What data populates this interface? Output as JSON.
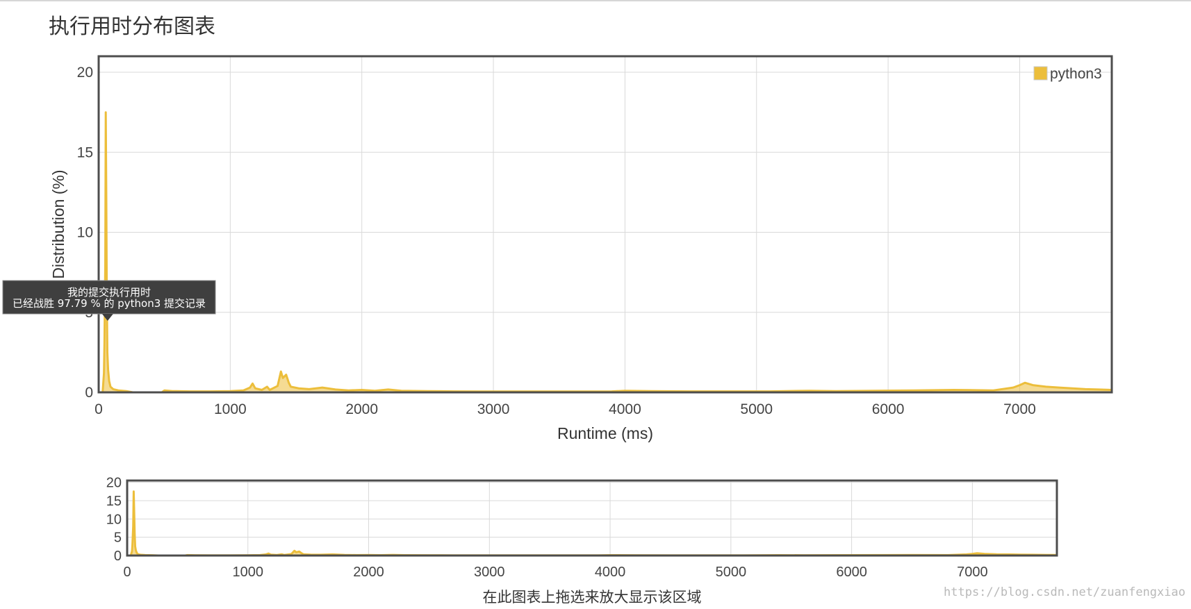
{
  "page": {
    "title": "执行用时分布图表",
    "watermark": "https://blog.csdn.net/zuanfengxiao"
  },
  "colors": {
    "series": "#ecbe3b",
    "grid": "#d9d9d9",
    "frame": "#4d4d4d",
    "tooltip_bg": "#3f3f3f"
  },
  "chart_data": [
    {
      "type": "area",
      "title": "",
      "xlabel": "Runtime (ms)",
      "ylabel": "Distribution (%)",
      "xlim": [
        0,
        7700
      ],
      "ylim": [
        0,
        21
      ],
      "xticks": [
        0,
        1000,
        2000,
        3000,
        4000,
        5000,
        6000,
        7000
      ],
      "yticks": [
        0,
        5,
        10,
        15,
        20
      ],
      "grid": true,
      "legend": {
        "position": "top-right",
        "entries": [
          "python3"
        ]
      },
      "series": [
        {
          "name": "python3",
          "points": [
            [
              0,
              0
            ],
            [
              30,
              0
            ],
            [
              40,
              1.2
            ],
            [
              44,
              3
            ],
            [
              50,
              8
            ],
            [
              54,
              17.5
            ],
            [
              58,
              12
            ],
            [
              62,
              6
            ],
            [
              66,
              2.5
            ],
            [
              72,
              1.4
            ],
            [
              80,
              0.7
            ],
            [
              90,
              0.35
            ],
            [
              110,
              0.2
            ],
            [
              150,
              0.12
            ],
            [
              210,
              0.08
            ],
            [
              260,
              0
            ],
            [
              480,
              0
            ],
            [
              500,
              0.12
            ],
            [
              560,
              0.08
            ],
            [
              700,
              0.06
            ],
            [
              850,
              0.06
            ],
            [
              1000,
              0.08
            ],
            [
              1100,
              0.12
            ],
            [
              1150,
              0.3
            ],
            [
              1170,
              0.55
            ],
            [
              1190,
              0.25
            ],
            [
              1240,
              0.15
            ],
            [
              1280,
              0.35
            ],
            [
              1300,
              0.15
            ],
            [
              1360,
              0.4
            ],
            [
              1385,
              1.3
            ],
            [
              1400,
              0.9
            ],
            [
              1425,
              1.1
            ],
            [
              1445,
              0.6
            ],
            [
              1460,
              0.35
            ],
            [
              1520,
              0.25
            ],
            [
              1600,
              0.2
            ],
            [
              1700,
              0.3
            ],
            [
              1800,
              0.18
            ],
            [
              1900,
              0.12
            ],
            [
              2000,
              0.15
            ],
            [
              2100,
              0.1
            ],
            [
              2200,
              0.18
            ],
            [
              2300,
              0.1
            ],
            [
              2500,
              0.08
            ],
            [
              2700,
              0.06
            ],
            [
              2900,
              0.05
            ],
            [
              3000,
              0.05
            ],
            [
              3300,
              0.05
            ],
            [
              3600,
              0.05
            ],
            [
              3900,
              0.06
            ],
            [
              4000,
              0.1
            ],
            [
              4200,
              0.08
            ],
            [
              4500,
              0.06
            ],
            [
              4800,
              0.06
            ],
            [
              5100,
              0.06
            ],
            [
              5400,
              0.1
            ],
            [
              5600,
              0.08
            ],
            [
              5900,
              0.1
            ],
            [
              6200,
              0.12
            ],
            [
              6500,
              0.15
            ],
            [
              6800,
              0.12
            ],
            [
              6950,
              0.3
            ],
            [
              7000,
              0.45
            ],
            [
              7040,
              0.6
            ],
            [
              7100,
              0.45
            ],
            [
              7200,
              0.35
            ],
            [
              7300,
              0.3
            ],
            [
              7400,
              0.25
            ],
            [
              7500,
              0.2
            ],
            [
              7600,
              0.18
            ],
            [
              7700,
              0.15
            ]
          ]
        }
      ],
      "annotation": {
        "x": 68,
        "lines": [
          "我的提交执行用时",
          "已经战胜 97.79 % 的 python3 提交记录"
        ]
      }
    },
    {
      "type": "area",
      "title": "",
      "xlabel": "在此图表上拖选来放大显示该区域",
      "ylabel": "",
      "xlim": [
        0,
        7700
      ],
      "ylim": [
        0,
        20.5
      ],
      "xticks": [
        0,
        1000,
        2000,
        3000,
        4000,
        5000,
        6000,
        7000
      ],
      "yticks": [
        0,
        5,
        10,
        15,
        20
      ],
      "grid": true,
      "series_ref": 0
    }
  ]
}
